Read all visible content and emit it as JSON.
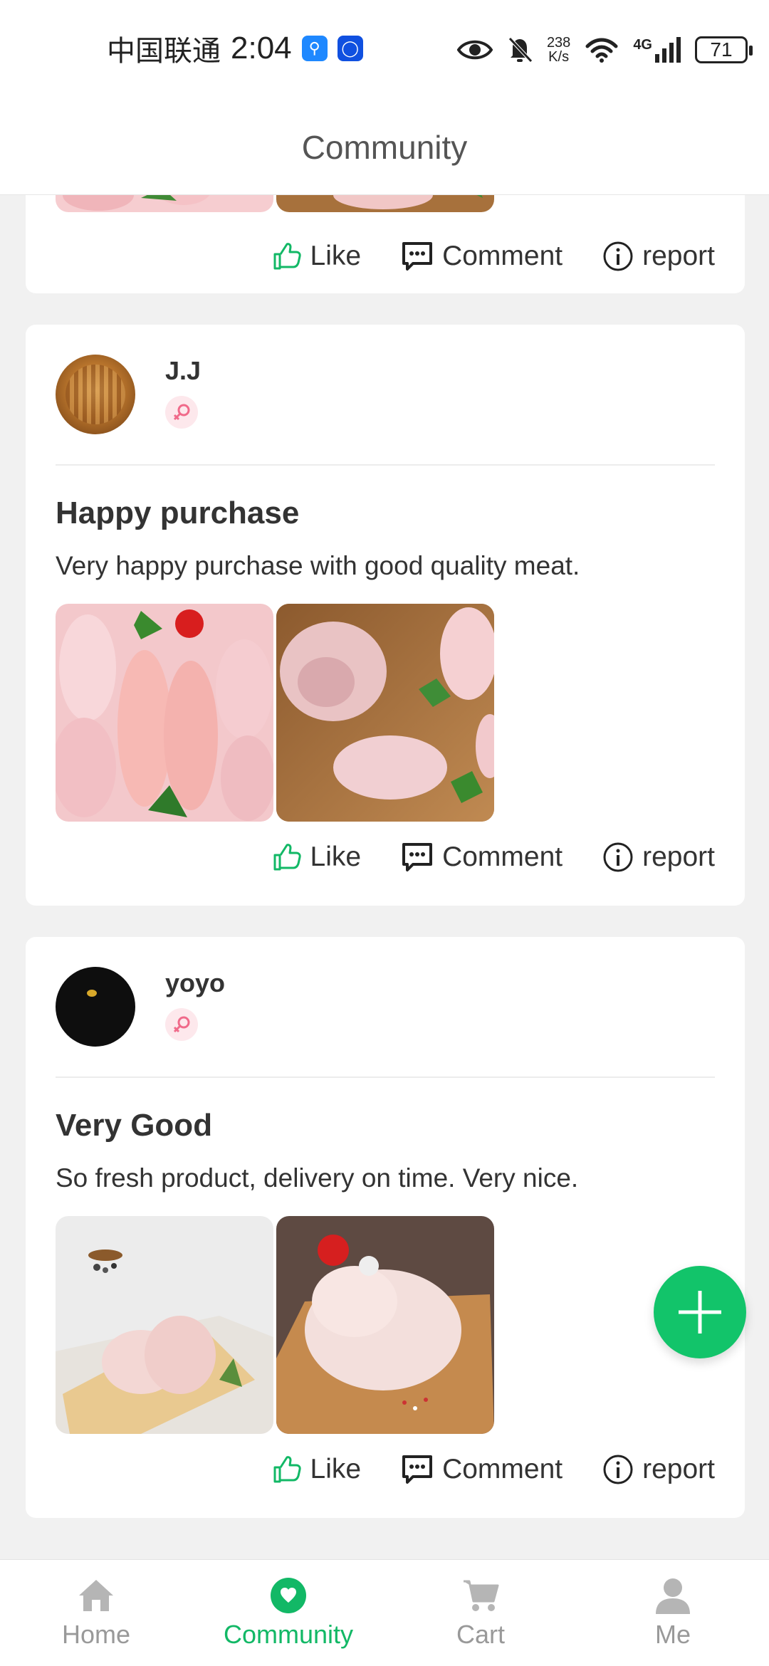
{
  "status_bar": {
    "carrier": "中国联通",
    "time": "2:04",
    "net_speed_value": "238",
    "net_speed_unit": "K/s",
    "network_type": "4G",
    "battery": "71"
  },
  "header": {
    "title": "Community"
  },
  "actions": {
    "like": "Like",
    "comment": "Comment",
    "report": "report"
  },
  "posts": [
    {
      "author": "J.J",
      "title": "Happy purchase",
      "text": "Very happy purchase with good quality meat."
    },
    {
      "author": "yoyo",
      "title": "Very Good",
      "text": "So fresh product, delivery on time. Very nice."
    }
  ],
  "bottom_nav": {
    "items": [
      {
        "label": "Home",
        "icon": "home-icon"
      },
      {
        "label": "Community",
        "icon": "community-icon"
      },
      {
        "label": "Cart",
        "icon": "cart-icon"
      },
      {
        "label": "Me",
        "icon": "person-icon"
      }
    ],
    "active": "Community"
  },
  "colors": {
    "accent": "#12C46A",
    "female_badge": "#F06A8A"
  }
}
